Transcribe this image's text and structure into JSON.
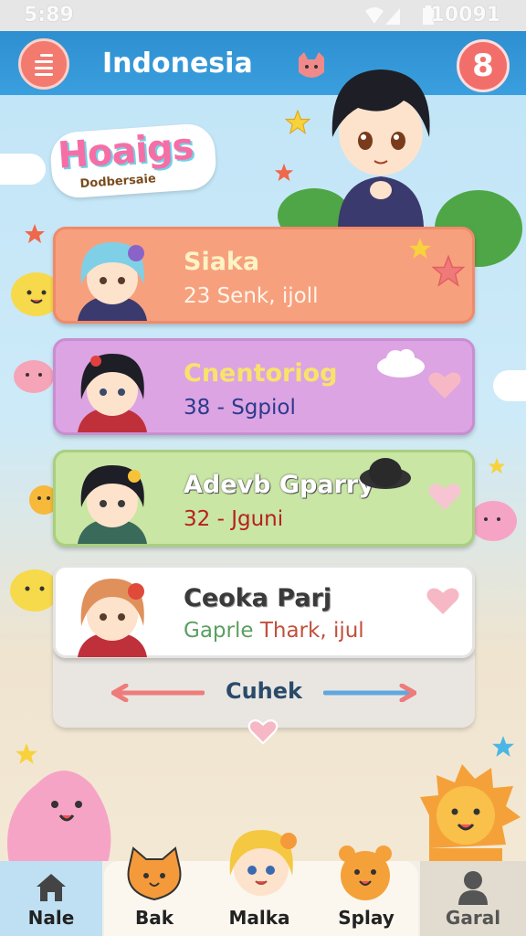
{
  "status_bar": {
    "time": "5:89",
    "right_text": "10091"
  },
  "app_bar": {
    "title": "Indonesia",
    "badge": "8"
  },
  "logo": {
    "line1": "Hoaigs",
    "line2": "Dodbersaie"
  },
  "cards": [
    {
      "name": "Siaka",
      "subtitle": "23 Senk, ijoll",
      "bg": "#f7a07e",
      "border": "#f08a6a",
      "name_color": "#fdf3c4",
      "sub_color": "#fff6ea"
    },
    {
      "name": "Cnentoriog",
      "subtitle": "38 - Sgpiol",
      "bg": "#dca4e3",
      "border": "#c98ed2",
      "name_color": "#f8e36a",
      "sub_color": "#2d3a8c"
    },
    {
      "name": "Adevb Gparry",
      "subtitle": "32 - Jguni",
      "bg": "#c9e6a4",
      "border": "#a9d07c",
      "name_color": "#ffffff",
      "sub_color": "#b82020"
    },
    {
      "name": "Ceoka Parj",
      "subtitle_part1": "Gaprle",
      "subtitle_part2": "Thark, ijul",
      "bg": "#ffffff",
      "border": "#e4e4e4",
      "name_color": "#3a3a3a",
      "sub_color1": "#5aa060",
      "sub_color2": "#c0503a"
    }
  ],
  "swipe": {
    "label": "Cuhek"
  },
  "tabs": [
    {
      "label": "Nale",
      "icon": "home-icon"
    },
    {
      "label": "Bak",
      "icon": "cat-mascot-icon"
    },
    {
      "label": "Malka",
      "icon": "girl-avatar-icon"
    },
    {
      "label": "Splay",
      "icon": "bear-mascot-icon"
    },
    {
      "label": "Garal",
      "icon": "person-icon"
    }
  ],
  "colors": {
    "accent": "#3a9fde",
    "coral": "#f27a6e",
    "heart": "#f7b8c6"
  }
}
